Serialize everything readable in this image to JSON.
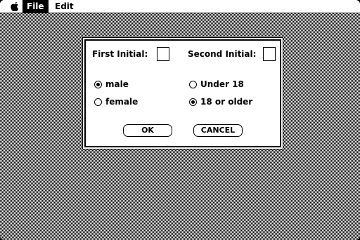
{
  "menubar": {
    "apple_icon": "apple-icon",
    "items": [
      {
        "label": "File",
        "selected": true
      },
      {
        "label": "Edit",
        "selected": false
      }
    ]
  },
  "dialog": {
    "first_initial_label": "First Initial:",
    "first_initial_value": "",
    "second_initial_label": "Second Initial:",
    "second_initial_value": "",
    "sex_options": [
      {
        "label": "male",
        "selected": true
      },
      {
        "label": "female",
        "selected": false
      }
    ],
    "age_options": [
      {
        "label": "Under 18",
        "selected": false
      },
      {
        "label": "18 or older",
        "selected": true
      }
    ],
    "ok_label": "OK",
    "cancel_label": "CANCEL"
  },
  "colors": {
    "foreground": "#000000",
    "background": "#ffffff"
  }
}
